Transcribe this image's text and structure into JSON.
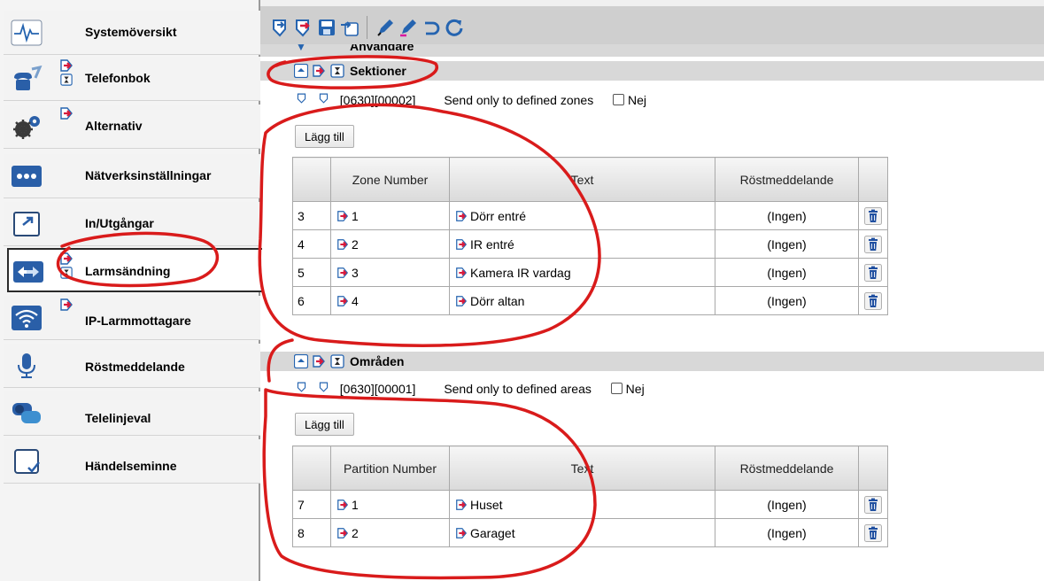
{
  "colors": {
    "annotation": "#d91b1b",
    "sidebar_bg": "#f4f4f4",
    "toolbar_bg": "#cfcfcf",
    "header_bg": "#d8d8d8",
    "icon_blue": "#2564b0",
    "icon_red": "#d81a3c"
  },
  "sidebar": {
    "items": [
      {
        "label": "Systemöversikt",
        "icon": "heartbeat-icon"
      },
      {
        "label": "Telefonbok",
        "icon": "phone-icon"
      },
      {
        "label": "Alternativ",
        "icon": "gears-icon"
      },
      {
        "label": "Nätverksinställningar",
        "icon": "dots-icon"
      },
      {
        "label": "In/Utgångar",
        "icon": "io-icon"
      },
      {
        "label": "Larmsändning",
        "icon": "arrows-icon"
      },
      {
        "label": "IP-Larmmottagare",
        "icon": "wifi-icon"
      },
      {
        "label": "Röstmeddelande",
        "icon": "microphone-icon"
      },
      {
        "label": "Telelinjeval",
        "icon": "speech-icon"
      },
      {
        "label": "Händelseminne",
        "icon": "checkbox-icon"
      }
    ]
  },
  "truncated_header": "Användare",
  "sektioner": {
    "title": "Sektioner",
    "code": "[0630][00002]",
    "description": "Send only to defined zones",
    "checkbox_label": "Nej",
    "add_button": "Lägg till",
    "columns": [
      "Zone Number",
      "Text",
      "Röstmeddelande"
    ],
    "rows": [
      {
        "index": "3",
        "number": "1",
        "text": "Dörr entré",
        "voice": "(Ingen)"
      },
      {
        "index": "4",
        "number": "2",
        "text": "IR entré",
        "voice": "(Ingen)"
      },
      {
        "index": "5",
        "number": "3",
        "text": "Kamera IR vardag",
        "voice": "(Ingen)"
      },
      {
        "index": "6",
        "number": "4",
        "text": "Dörr altan",
        "voice": "(Ingen)"
      }
    ]
  },
  "omraden": {
    "title": "Områden",
    "code": "[0630][00001]",
    "description": "Send only to defined areas",
    "checkbox_label": "Nej",
    "add_button": "Lägg till",
    "columns": [
      "Partition Number",
      "Text",
      "Röstmeddelande"
    ],
    "rows": [
      {
        "index": "7",
        "number": "1",
        "text": "Huset",
        "voice": "(Ingen)"
      },
      {
        "index": "8",
        "number": "2",
        "text": "Garaget",
        "voice": "(Ingen)"
      }
    ]
  }
}
